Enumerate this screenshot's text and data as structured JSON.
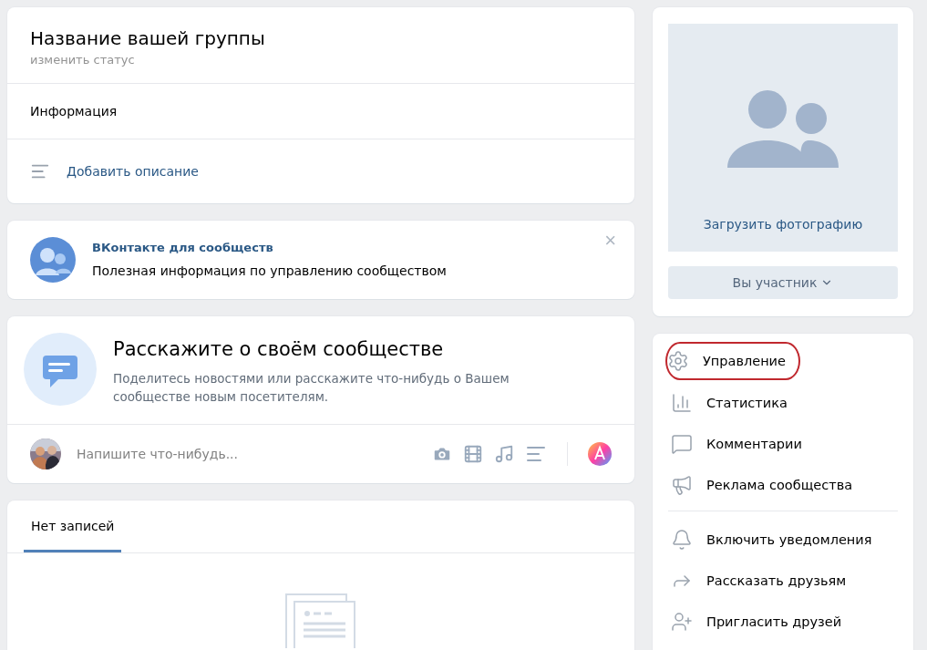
{
  "group": {
    "title": "Название вашей группы",
    "status": "изменить статус",
    "info_label": "Информация",
    "add_description": "Добавить описание"
  },
  "promo": {
    "title": "ВКонтакте для сообществ",
    "text": "Полезная информация по управлению сообществом",
    "close": "×"
  },
  "story": {
    "title": "Расскажите о своём сообществе",
    "text": "Поделитесь новостями или расскажите что-нибудь о Вашем сообществе новым посетителям.",
    "composer": {
      "placeholder": "Напишите что-нибудь..."
    }
  },
  "wall": {
    "tabs": [
      {
        "label": "Нет записей",
        "selected": true
      }
    ]
  },
  "cover": {
    "upload": "Загрузить фотографию",
    "member_button": "Вы участник"
  },
  "menu": {
    "groups": [
      {
        "items": [
          {
            "label": "Управление",
            "highlighted": true
          },
          {
            "label": "Статистика",
            "highlighted": false
          },
          {
            "label": "Комментарии",
            "highlighted": false
          },
          {
            "label": "Реклама сообщества",
            "highlighted": false
          }
        ]
      },
      {
        "items": [
          {
            "label": "Включить уведомления",
            "highlighted": false
          },
          {
            "label": "Рассказать друзьям",
            "highlighted": false
          },
          {
            "label": "Пригласить друзей",
            "highlighted": false
          }
        ]
      }
    ]
  }
}
